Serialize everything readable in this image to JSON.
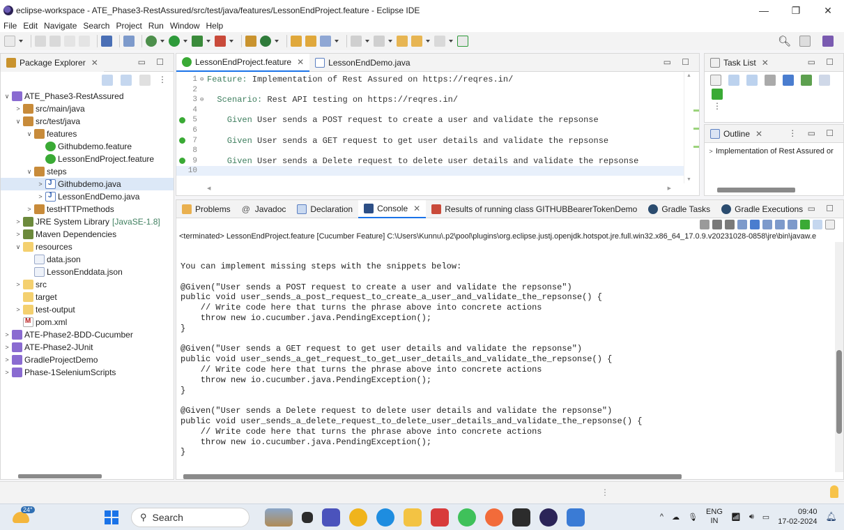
{
  "window": {
    "title": "eclipse-workspace - ATE_Phase3-RestAssured/src/test/java/features/LessonEndProject.feature - Eclipse IDE",
    "controls": [
      "—",
      "❐",
      "✕"
    ]
  },
  "menu": [
    "File",
    "Edit",
    "Navigate",
    "Search",
    "Project",
    "Run",
    "Window",
    "Help"
  ],
  "package_explorer": {
    "tab_label": "Package Explorer",
    "tree": [
      {
        "label": "ATE_Phase3-RestAssured",
        "indent": 0,
        "arrow": "v",
        "icon": "proj"
      },
      {
        "label": "src/main/java",
        "indent": 1,
        "arrow": ">",
        "icon": "pkgf"
      },
      {
        "label": "src/test/java",
        "indent": 1,
        "arrow": "v",
        "icon": "pkgf"
      },
      {
        "label": "features",
        "indent": 2,
        "arrow": "v",
        "icon": "pkgf"
      },
      {
        "label": "Githubdemo.feature",
        "indent": 3,
        "arrow": "",
        "icon": "cuke"
      },
      {
        "label": "LessonEndProject.feature",
        "indent": 3,
        "arrow": "",
        "icon": "cuke"
      },
      {
        "label": "steps",
        "indent": 2,
        "arrow": "v",
        "icon": "pkgf"
      },
      {
        "label": "Githubdemo.java",
        "indent": 3,
        "arrow": ">",
        "icon": "java",
        "selected": true
      },
      {
        "label": "LessonEndDemo.java",
        "indent": 3,
        "arrow": ">",
        "icon": "java"
      },
      {
        "label": "testHTTPmethods",
        "indent": 2,
        "arrow": ">",
        "icon": "pkgf"
      },
      {
        "label": "JRE System Library",
        "suffix": "[JavaSE-1.8]",
        "indent": 1,
        "arrow": ">",
        "icon": "lib"
      },
      {
        "label": "Maven Dependencies",
        "indent": 1,
        "arrow": ">",
        "icon": "lib"
      },
      {
        "label": "resources",
        "indent": 1,
        "arrow": "v",
        "icon": "folder"
      },
      {
        "label": "data.json",
        "indent": 2,
        "arrow": "",
        "icon": "file"
      },
      {
        "label": "LessonEnddata.json",
        "indent": 2,
        "arrow": "",
        "icon": "file"
      },
      {
        "label": "src",
        "indent": 1,
        "arrow": ">",
        "icon": "folder"
      },
      {
        "label": "target",
        "indent": 1,
        "arrow": "",
        "icon": "folder"
      },
      {
        "label": "test-output",
        "indent": 1,
        "arrow": ">",
        "icon": "folder"
      },
      {
        "label": "pom.xml",
        "indent": 1,
        "arrow": "",
        "icon": "mvn"
      },
      {
        "label": "ATE-Phase2-BDD-Cucumber",
        "indent": 0,
        "arrow": ">",
        "icon": "proj"
      },
      {
        "label": "ATE-Phase2-JUnit",
        "indent": 0,
        "arrow": ">",
        "icon": "proj"
      },
      {
        "label": "GradleProjectDemo",
        "indent": 0,
        "arrow": ">",
        "icon": "proj"
      },
      {
        "label": "Phase-1SeleniumScripts",
        "indent": 0,
        "arrow": ">",
        "icon": "proj"
      }
    ]
  },
  "editor": {
    "tabs": [
      {
        "label": "LessonEndProject.feature",
        "active": true
      },
      {
        "label": "LessonEndDemo.java",
        "active": false
      }
    ],
    "lines": [
      {
        "n": "1",
        "fold": "⊖",
        "kw": "Feature:",
        "text": " Implementation of Rest Assured on https://reqres.in/"
      },
      {
        "n": "2",
        "fold": "",
        "kw": "",
        "text": ""
      },
      {
        "n": "3",
        "fold": "⊖",
        "kw": "  Scenario:",
        "text": " Rest API testing on https://reqres.in/"
      },
      {
        "n": "4",
        "fold": "",
        "kw": "",
        "text": ""
      },
      {
        "n": "5",
        "fold": "",
        "kw": "    Given",
        "text": " User sends a POST request to create a user and validate the repsonse",
        "bullet": true
      },
      {
        "n": "6",
        "fold": "",
        "kw": "",
        "text": ""
      },
      {
        "n": "7",
        "fold": "",
        "kw": "    Given",
        "text": " User sends a GET request to get user details and validate the repsonse",
        "bullet": true
      },
      {
        "n": "8",
        "fold": "",
        "kw": "",
        "text": ""
      },
      {
        "n": "9",
        "fold": "",
        "kw": "    Given",
        "text": " User sends a Delete request to delete user details and validate the repsonse",
        "bullet": true
      },
      {
        "n": "10",
        "fold": "",
        "kw": "",
        "text": "",
        "current": true
      }
    ]
  },
  "task_list": {
    "tab_label": "Task List"
  },
  "outline": {
    "tab_label": "Outline",
    "item": "Implementation of Rest Assured or"
  },
  "console": {
    "tabs": [
      "Problems",
      "Javadoc",
      "Declaration",
      "Console",
      "Results of running class GITHUBBearerTokenDemo",
      "Gradle Tasks",
      "Gradle Executions"
    ],
    "active_tab": "Console",
    "terminated": "<terminated> LessonEndProject.feature [Cucumber Feature] C:\\Users\\Kunnu\\.p2\\pool\\plugins\\org.eclipse.justj.openjdk.hotspot.jre.full.win32.x86_64_17.0.9.v20231028-0858\\jre\\bin\\javaw.e",
    "output": "You can implement missing steps with the snippets below:\n\n@Given(\"User sends a POST request to create a user and validate the repsonse\")\npublic void user_sends_a_post_request_to_create_a_user_and_validate_the_repsonse() {\n    // Write code here that turns the phrase above into concrete actions\n    throw new io.cucumber.java.PendingException();\n}\n\n@Given(\"User sends a GET request to get user details and validate the repsonse\")\npublic void user_sends_a_get_request_to_get_user_details_and_validate_the_repsonse() {\n    // Write code here that turns the phrase above into concrete actions\n    throw new io.cucumber.java.PendingException();\n}\n\n@Given(\"User sends a Delete request to delete user details and validate the repsonse\")\npublic void user_sends_a_delete_request_to_delete_user_details_and_validate_the_repsonse() {\n    // Write code here that turns the phrase above into concrete actions\n    throw new io.cucumber.java.PendingException();\n}"
  },
  "taskbar": {
    "weather_temp": "24°",
    "search_label": "Search",
    "lang_top": "ENG",
    "lang_bottom": "IN",
    "time": "09:40",
    "date": "17-02-2024"
  },
  "colors": {
    "accent": "#1a73e8",
    "gherkin_keyword": "#3f7f5f",
    "cucumber_green": "#3aaa35"
  }
}
